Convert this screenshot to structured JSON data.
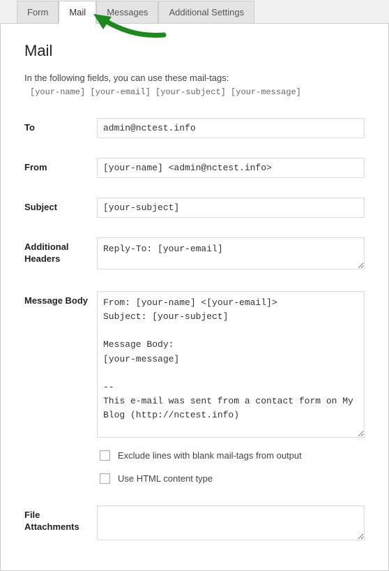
{
  "tabs": {
    "form": "Form",
    "mail": "Mail",
    "messages": "Messages",
    "additional": "Additional Settings"
  },
  "title": "Mail",
  "hint": "In the following fields, you can use these mail-tags:",
  "mail_tags_line": "[your-name] [your-email] [your-subject] [your-message]",
  "labels": {
    "to": "To",
    "from": "From",
    "subject": "Subject",
    "additional_headers": "Additional Headers",
    "message_body": "Message Body",
    "file_attachments": "File Attachments"
  },
  "values": {
    "to": "admin@nctest.info",
    "from": "[your-name] <admin@nctest.info>",
    "subject": "[your-subject]",
    "additional_headers": "Reply-To: [your-email]",
    "message_body": "From: [your-name] <[your-email]>\nSubject: [your-subject]\n\nMessage Body:\n[your-message]\n\n--\nThis e-mail was sent from a contact form on My Blog (http://nctest.info)",
    "file_attachments": ""
  },
  "checkboxes": {
    "exclude_blank": "Exclude lines with blank mail-tags from output",
    "use_html": "Use HTML content type"
  }
}
